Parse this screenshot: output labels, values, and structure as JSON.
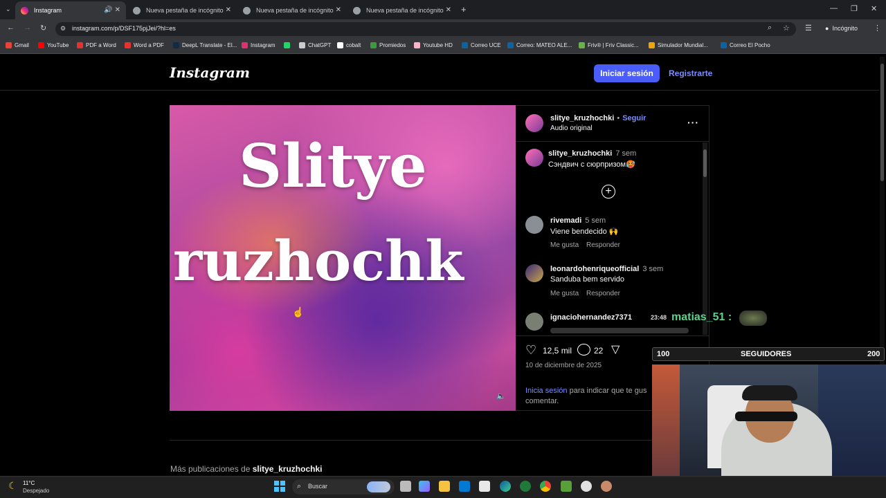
{
  "browser": {
    "tabs": [
      {
        "label": "Instagram",
        "active": true
      },
      {
        "label": "Nueva pestaña de incógnito",
        "active": false
      },
      {
        "label": "Nueva pestaña de incógnito",
        "active": false
      },
      {
        "label": "Nueva pestaña de incógnito",
        "active": false
      }
    ],
    "url": "instagram.com/p/DSF175pjJei/?hl=es",
    "incognito_label": "Incógnito",
    "bookmarks": [
      {
        "label": "Gmail",
        "color": "#ea4335"
      },
      {
        "label": "YouTube",
        "color": "#ff0000"
      },
      {
        "label": "PDF a Word",
        "color": "#e5322d"
      },
      {
        "label": "Word a PDF",
        "color": "#e5322d"
      },
      {
        "label": "DeepL Translate - El...",
        "color": "#0f2b46"
      },
      {
        "label": "Instagram",
        "color": "#e1306c"
      },
      {
        "label": "",
        "color": "#25d366"
      },
      {
        "label": "ChatGPT",
        "color": "#cccccc"
      },
      {
        "label": "cobalt",
        "color": "#ffffff"
      },
      {
        "label": "Promiedos",
        "color": "#3c9a3c"
      },
      {
        "label": "Youtube HD",
        "color": "#f8b4c8"
      },
      {
        "label": "Correo UCE",
        "color": "#0a64a4"
      },
      {
        "label": "Correo: MATEO ALE...",
        "color": "#0a64a4"
      },
      {
        "label": "Friv® | Friv Classic...",
        "color": "#6ab04c"
      },
      {
        "label": "Simulador Mundial...",
        "color": "#f0a500"
      },
      {
        "label": "Correo El Pocho",
        "color": "#0a64a4"
      }
    ]
  },
  "instagram": {
    "logo": "Instagram",
    "login_label": "Iniciar sesión",
    "register_label": "Registrarte",
    "media_text_line1": "Slitye",
    "media_text_line2": "ruzhochk",
    "post_user": "slitye_kruzhochki",
    "follow_label": "Seguir",
    "audio_label": "Audio original",
    "caption": {
      "user": "slitye_kruzhochki",
      "time": "7 sem",
      "text": "Сэндвич с сюрпризом🥵"
    },
    "comments": [
      {
        "user": "rivemadi",
        "time": "5 sem",
        "text": "Viene bendecido 🙌",
        "like": "Me gusta",
        "reply": "Responder"
      },
      {
        "user": "leonardohenriqueofficial",
        "time": "3 sem",
        "text": "Sanduba bem servido",
        "like": "Me gusta",
        "reply": "Responder"
      },
      {
        "user": "ignaciohernandez7371",
        "time": "",
        "text": "",
        "like": "",
        "reply": ""
      }
    ],
    "likes": "12,5 mil",
    "comments_count": "22",
    "date": "10 de diciembre de 2025",
    "login_prompt_link": "Inicia sesión",
    "login_prompt_line1": "para indicar que te gus",
    "login_prompt_line2": "comentar.",
    "more_posts_prefix": "Más publicaciones de",
    "more_posts_user": "slitye_kruzhochki"
  },
  "overlay": {
    "chat_time": "23:48",
    "chat_user": "matias_51 :",
    "follow_min": "100",
    "follow_label": "SEGUIDORES",
    "follow_max": "200"
  },
  "taskbar": {
    "weather_temp": "11°C",
    "weather_desc": "Despejado",
    "search_label": "Buscar"
  }
}
